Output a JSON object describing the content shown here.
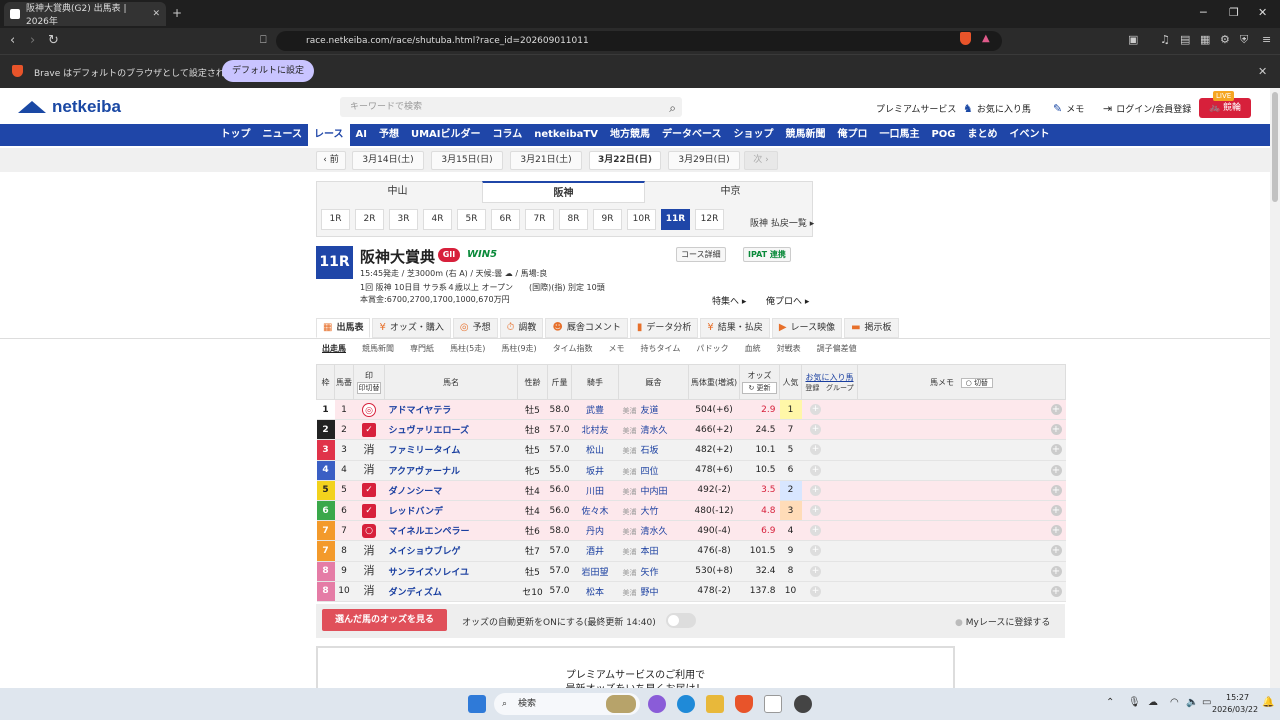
{
  "browser": {
    "tab_title": "阪神大賞典(G2) 出馬表 | 2026年",
    "url": "race.netkeiba.com/race/shutuba.html?race_id=202609011011",
    "default_msg": "Brave はデフォルトのブラウザとして設定されていません",
    "default_btn": "デフォルトに設定"
  },
  "header": {
    "logo": "netkeiba",
    "search_placeholder": "キーワードで検索",
    "premium": "プレミアムサービス",
    "favorites": "お気に入り馬",
    "memo": "メモ",
    "login": "ログイン/会員登録",
    "live_badge": "LIVE",
    "live_label": "競輪"
  },
  "gnav": [
    "トップ",
    "ニュース",
    "レース",
    "AI",
    "予想",
    "UMAIビルダー",
    "コラム",
    "netkeibaTV",
    "地方競馬",
    "データベース",
    "ショップ",
    "競馬新聞",
    "俺プロ",
    "一口馬主",
    "POG",
    "まとめ",
    "イベント"
  ],
  "gnav_active": 2,
  "datebar": {
    "prev": "‹ 前",
    "dates": [
      "3月14日(土)",
      "3月15日(日)",
      "3月21日(土)",
      "3月22日(日)",
      "3月29日(日)"
    ],
    "next": "次 ›"
  },
  "venues": [
    "中山",
    "阪神",
    "中京"
  ],
  "races": [
    "1R",
    "2R",
    "3R",
    "4R",
    "5R",
    "6R",
    "7R",
    "8R",
    "9R",
    "10R",
    "11R",
    "12R"
  ],
  "race_list_link": "阪神 払戻一覧 ▸",
  "race": {
    "num": "11R",
    "name": "阪神大賞典",
    "grade": "GII",
    "win5": "WIN5",
    "line1": "15:45発走 / 芝3000m (右 A) / 天候:曇 ☁ / 馬場:良",
    "line2": "1回 阪神 10日目 サラ系４歳以上 オープン　　(国際)(指) 別定 10頭",
    "line3": "本賞金:6700,2700,1700,1000,670万円",
    "course_btn": "コース詳細",
    "ipat_btn": "IPAT 連携",
    "feature_link": "特集へ ▸",
    "orepro_link": "俺プロへ ▸"
  },
  "subtabs": [
    "出馬表",
    "オッズ・購入",
    "予想",
    "調教",
    "厩舎コメント",
    "データ分析",
    "結果・払戻",
    "レース映像",
    "掲示板"
  ],
  "subsub": [
    "出走馬",
    "競馬新聞",
    "専門紙",
    "馬柱(5走)",
    "馬柱(9走)",
    "タイム指数",
    "メモ",
    "持ちタイム",
    "パドック",
    "血統",
    "対戦表",
    "調子偏差値"
  ],
  "columns": {
    "waku": "枠",
    "umaban": "馬番",
    "mark": "印",
    "mark_sub": "印切替",
    "horse": "馬名",
    "sexage": "性齢",
    "weight": "斤量",
    "jockey": "騎手",
    "trainer": "厩舎",
    "bodyweight": "馬体重(増減)",
    "odds": "オッズ",
    "odds_update": "更新",
    "pop": "人気",
    "fav": "お気に入り馬",
    "fav_sub1": "登録",
    "fav_sub2": "グループ",
    "memo": "馬メモ",
    "memo_btn": "切替"
  },
  "horses": [
    {
      "waku": "1",
      "num": "1",
      "mark": "◎",
      "mtype": "dbl",
      "name": "アドマイヤテラ",
      "sexage": "牡5",
      "weight": "58.0",
      "jockey": "武豊",
      "region": "美浦",
      "trainer": "友道",
      "bw": "504(+6)",
      "odds": "2.9",
      "pop": "1",
      "row": "pink"
    },
    {
      "waku": "2",
      "num": "2",
      "mark": "✓",
      "mtype": "chk",
      "name": "シュヴァリエローズ",
      "sexage": "牡8",
      "weight": "57.0",
      "jockey": "北村友",
      "region": "美浦",
      "trainer": "清水久",
      "bw": "466(+2)",
      "odds": "24.5",
      "pop": "7",
      "row": "pink"
    },
    {
      "waku": "3",
      "num": "3",
      "mark": "消",
      "mtype": "scr",
      "name": "ファミリータイム",
      "sexage": "牡5",
      "weight": "57.0",
      "jockey": "松山",
      "region": "美浦",
      "trainer": "石坂",
      "bw": "482(+2)",
      "odds": "10.1",
      "pop": "5",
      "row": "gray"
    },
    {
      "waku": "4",
      "num": "4",
      "mark": "消",
      "mtype": "scr",
      "name": "アクアヴァーナル",
      "sexage": "牝5",
      "weight": "55.0",
      "jockey": "坂井",
      "region": "美浦",
      "trainer": "四位",
      "bw": "478(+6)",
      "odds": "10.5",
      "pop": "6",
      "row": "gray"
    },
    {
      "waku": "5",
      "num": "5",
      "mark": "✓",
      "mtype": "chk",
      "name": "ダノンシーマ",
      "sexage": "牡4",
      "weight": "56.0",
      "jockey": "川田",
      "region": "美浦",
      "trainer": "中内田",
      "bw": "492(-2)",
      "odds": "3.5",
      "pop": "2",
      "row": "pink"
    },
    {
      "waku": "6",
      "num": "6",
      "mark": "✓",
      "mtype": "chk",
      "name": "レッドバンデ",
      "sexage": "牡4",
      "weight": "56.0",
      "jockey": "佐々木",
      "region": "美浦",
      "trainer": "大竹",
      "bw": "480(-12)",
      "odds": "4.8",
      "pop": "3",
      "row": "pink"
    },
    {
      "waku": "7",
      "num": "7",
      "mark": "○",
      "mtype": "rnd",
      "name": "マイネルエンペラー",
      "sexage": "牡6",
      "weight": "58.0",
      "jockey": "丹内",
      "region": "美浦",
      "trainer": "清水久",
      "bw": "490(-4)",
      "odds": "6.9",
      "pop": "4",
      "row": "pink"
    },
    {
      "waku": "7",
      "num": "8",
      "mark": "消",
      "mtype": "scr",
      "name": "メイショウブレゲ",
      "sexage": "牡7",
      "weight": "57.0",
      "jockey": "酒井",
      "region": "美浦",
      "trainer": "本田",
      "bw": "476(-8)",
      "odds": "101.5",
      "pop": "9",
      "row": "gray"
    },
    {
      "waku": "8",
      "num": "9",
      "mark": "消",
      "mtype": "scr",
      "name": "サンライズソレイユ",
      "sexage": "牡5",
      "weight": "57.0",
      "jockey": "岩田望",
      "region": "美浦",
      "trainer": "矢作",
      "bw": "530(+8)",
      "odds": "32.4",
      "pop": "8",
      "row": "gray"
    },
    {
      "waku": "8",
      "num": "10",
      "mark": "消",
      "mtype": "scr",
      "name": "ダンディズム",
      "sexage": "セ10",
      "weight": "57.0",
      "jockey": "松本",
      "region": "美浦",
      "trainer": "野中",
      "bw": "478(-2)",
      "odds": "137.8",
      "pop": "10",
      "row": "gray"
    }
  ],
  "waku_colors": {
    "1": "#ffffff",
    "2": "#222222",
    "3": "#e0334a",
    "4": "#3a5fc4",
    "5": "#f2d21d",
    "6": "#3aa84a",
    "7": "#f39a2b",
    "8": "#e57ca6"
  },
  "footer": {
    "odds_btn": "選んだ馬のオッズを見る",
    "auto_update": "オッズの自動更新をONにする(最終更新 14:40)",
    "myrace": "Myレースに登録する"
  },
  "premium": {
    "line1": "プレミアムサービスのご利用で",
    "line2": "最新オッズをいち早くお届け！"
  },
  "taskbar": {
    "search": "検索",
    "time": "15:27",
    "date": "2026/03/22"
  }
}
